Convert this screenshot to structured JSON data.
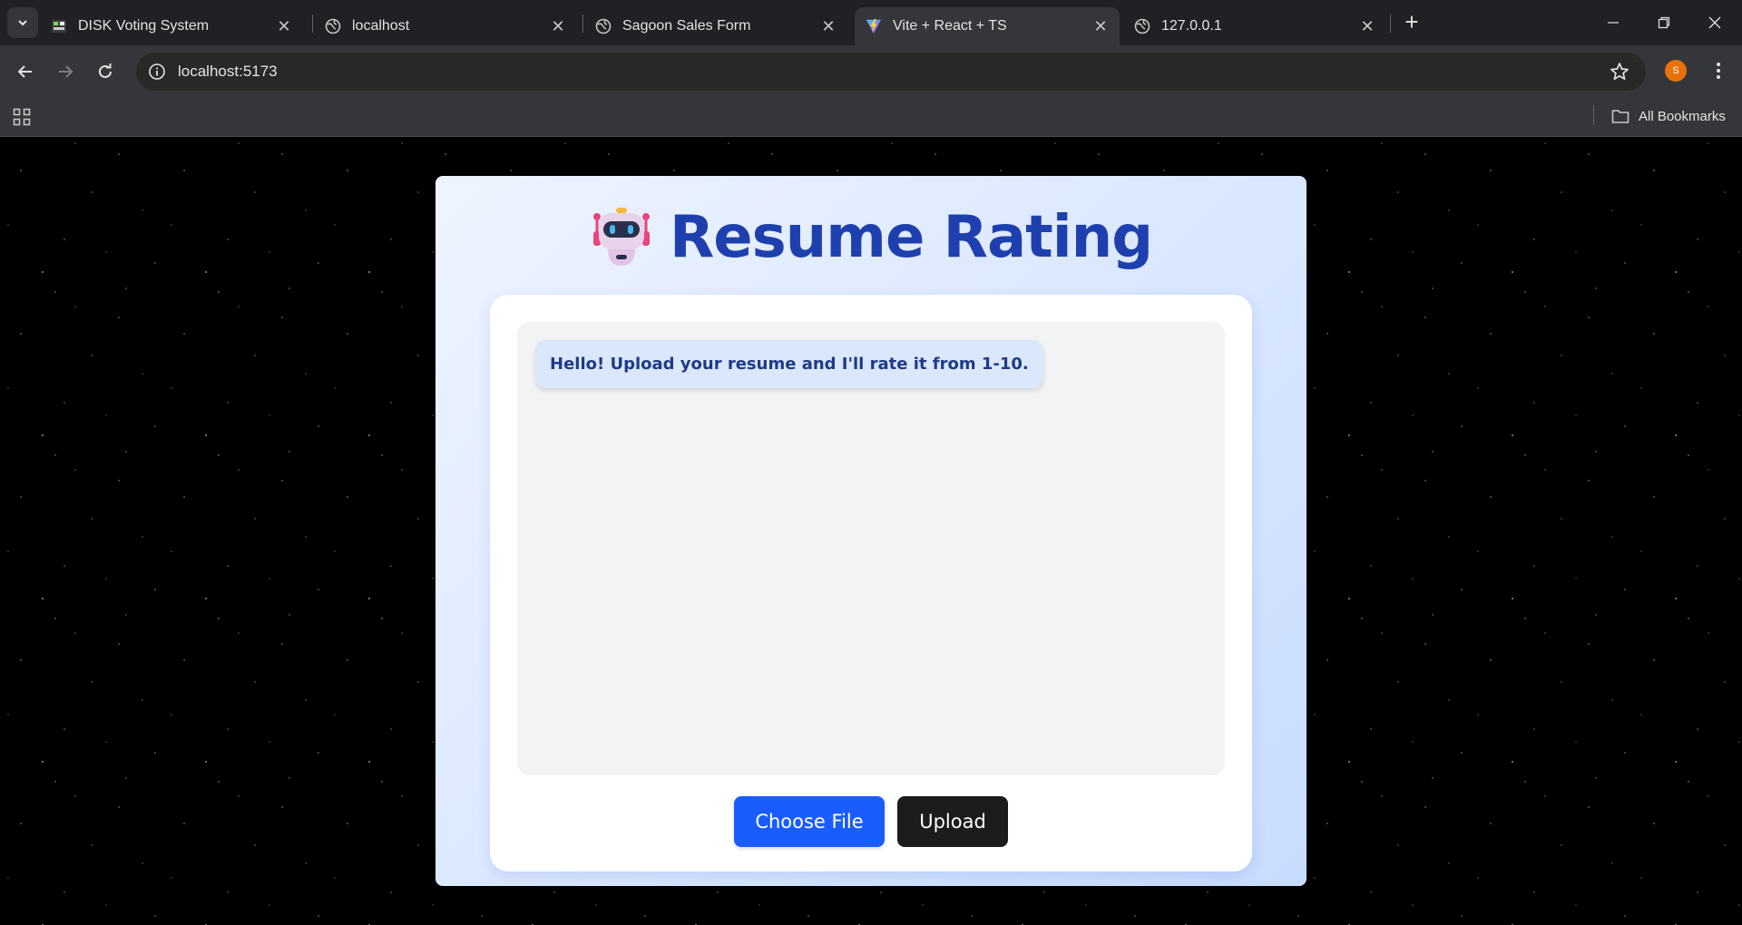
{
  "browser": {
    "tabs": [
      {
        "title": "DISK Voting System",
        "icon": "disk-favicon",
        "active": false
      },
      {
        "title": "localhost",
        "icon": "globe-icon",
        "active": false
      },
      {
        "title": "Sagoon Sales Form",
        "icon": "globe-icon",
        "active": false
      },
      {
        "title": "Vite + React + TS",
        "icon": "vite-icon",
        "active": true
      },
      {
        "title": "127.0.0.1",
        "icon": "globe-icon",
        "active": false
      }
    ],
    "url": "localhost:5173",
    "profile_initial": "S",
    "bookmarks_label": "All Bookmarks"
  },
  "app": {
    "title": "Resume Rating",
    "title_icon": "robot-icon",
    "messages": [
      {
        "sender": "bot",
        "text": "Hello! Upload your resume and I'll rate it from 1-10."
      }
    ],
    "choose_file_label": "Choose File",
    "upload_label": "Upload"
  },
  "colors": {
    "title": "#1e40af",
    "choose_button": "#1a5cff",
    "upload_button": "#1c1c1c",
    "bubble_bg": "#dbe7fb",
    "bubble_text": "#1e3a8a"
  }
}
